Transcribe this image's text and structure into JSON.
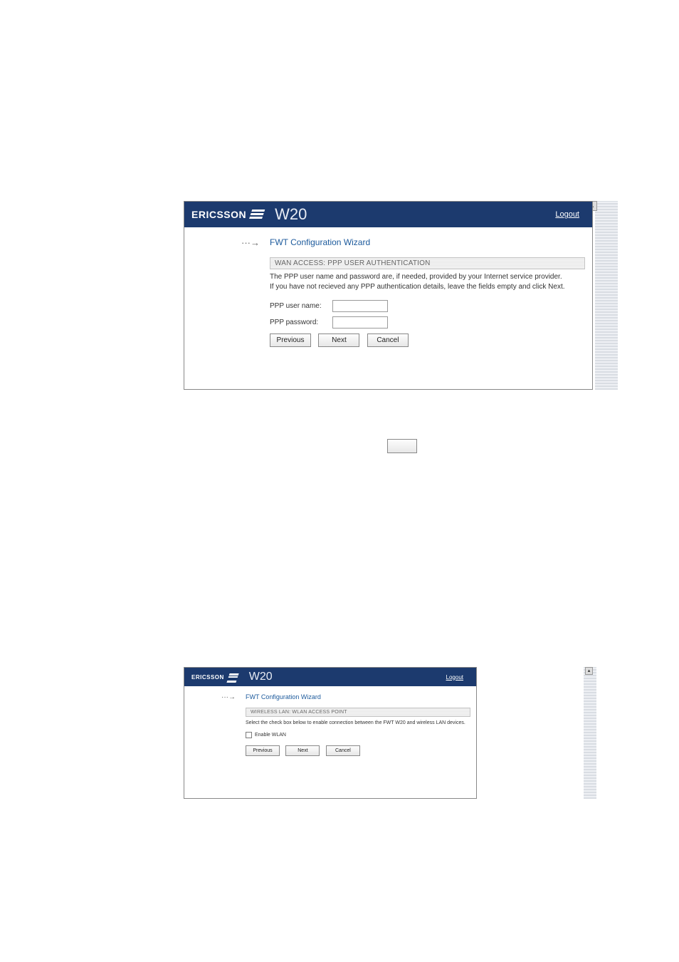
{
  "brand": "ERICSSON",
  "model": "W20",
  "logout_label": "Logout",
  "arrow_glyph": "···→",
  "wizard_title": "FWT Configuration Wizard",
  "fig1": {
    "section_header": "WAN ACCESS: PPP USER AUTHENTICATION",
    "desc_line1": "The PPP user name and password are, if needed, provided by your Internet service provider.",
    "desc_line2": "If you have not recieved any PPP authentication details, leave the fields empty and click Next.",
    "field_user_label": "PPP user name:",
    "field_user_value": "",
    "field_pass_label": "PPP password:",
    "field_pass_value": "",
    "btn_prev": "Previous",
    "btn_next": "Next",
    "btn_cancel": "Cancel"
  },
  "fig2": {
    "section_header": "WIRELESS LAN: WLAN ACCESS POINT",
    "desc": "Select the check box below to enable connection between the FWT W20 and wireless LAN devices.",
    "chk_label": "Enable WLAN",
    "chk_checked": false,
    "btn_prev": "Previous",
    "btn_next": "Next",
    "btn_cancel": "Cancel"
  }
}
